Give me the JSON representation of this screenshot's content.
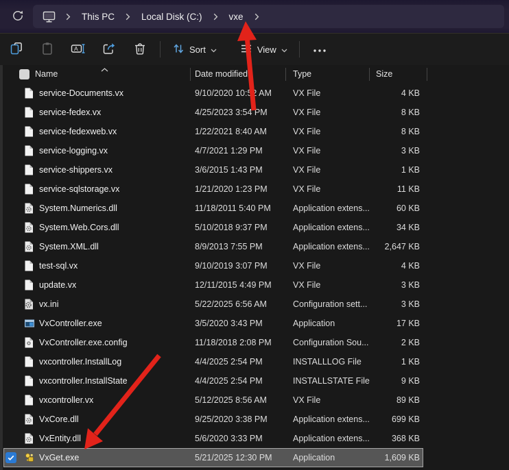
{
  "breadcrumb": {
    "items": [
      "This PC",
      "Local Disk (C:)",
      "vxe"
    ]
  },
  "toolbar": {
    "sort_label": "Sort",
    "view_label": "View",
    "icons": [
      "refresh-icon",
      "copy-icon",
      "paste-icon",
      "rename-icon",
      "share-icon",
      "delete-icon",
      "sort-icon",
      "view-icon",
      "more-icon"
    ]
  },
  "list": {
    "columns": [
      "Name",
      "Date modified",
      "Type",
      "Size"
    ],
    "sort": {
      "column": "Name",
      "direction": "ascending"
    },
    "rows": [
      {
        "name": "service-Documents.vx",
        "date": "9/10/2020 10:52 AM",
        "type": "VX File",
        "size": "4 KB",
        "icon": "file",
        "selected": false
      },
      {
        "name": "service-fedex.vx",
        "date": "4/25/2023 3:54 PM",
        "type": "VX File",
        "size": "8 KB",
        "icon": "file",
        "selected": false
      },
      {
        "name": "service-fedexweb.vx",
        "date": "1/22/2021 8:40 AM",
        "type": "VX File",
        "size": "8 KB",
        "icon": "file",
        "selected": false
      },
      {
        "name": "service-logging.vx",
        "date": "4/7/2021 1:29 PM",
        "type": "VX File",
        "size": "3 KB",
        "icon": "file",
        "selected": false
      },
      {
        "name": "service-shippers.vx",
        "date": "3/6/2015 1:43 PM",
        "type": "VX File",
        "size": "1 KB",
        "icon": "file",
        "selected": false
      },
      {
        "name": "service-sqlstorage.vx",
        "date": "1/21/2020 1:23 PM",
        "type": "VX File",
        "size": "11 KB",
        "icon": "file",
        "selected": false
      },
      {
        "name": "System.Numerics.dll",
        "date": "11/18/2011 5:40 PM",
        "type": "Application extens...",
        "size": "60 KB",
        "icon": "dll",
        "selected": false
      },
      {
        "name": "System.Web.Cors.dll",
        "date": "5/10/2018 9:37 PM",
        "type": "Application extens...",
        "size": "34 KB",
        "icon": "dll",
        "selected": false
      },
      {
        "name": "System.XML.dll",
        "date": "8/9/2013 7:55 PM",
        "type": "Application extens...",
        "size": "2,647 KB",
        "icon": "dll",
        "selected": false
      },
      {
        "name": "test-sql.vx",
        "date": "9/10/2019 3:07 PM",
        "type": "VX File",
        "size": "4 KB",
        "icon": "file",
        "selected": false
      },
      {
        "name": "update.vx",
        "date": "12/11/2015 4:49 PM",
        "type": "VX File",
        "size": "3 KB",
        "icon": "file",
        "selected": false
      },
      {
        "name": "vx.ini",
        "date": "5/22/2025 6:56 AM",
        "type": "Configuration sett...",
        "size": "3 KB",
        "icon": "ini",
        "selected": false
      },
      {
        "name": "VxController.exe",
        "date": "3/5/2020 3:43 PM",
        "type": "Application",
        "size": "17 KB",
        "icon": "exe",
        "selected": false
      },
      {
        "name": "VxController.exe.config",
        "date": "11/18/2018 2:08 PM",
        "type": "Configuration Sou...",
        "size": "2 KB",
        "icon": "config",
        "selected": false
      },
      {
        "name": "vxcontroller.InstallLog",
        "date": "4/4/2025 2:54 PM",
        "type": "INSTALLLOG File",
        "size": "1 KB",
        "icon": "file",
        "selected": false
      },
      {
        "name": "vxcontroller.InstallState",
        "date": "4/4/2025 2:54 PM",
        "type": "INSTALLSTATE File",
        "size": "9 KB",
        "icon": "file",
        "selected": false
      },
      {
        "name": "vxcontroller.vx",
        "date": "5/12/2025 8:56 AM",
        "type": "VX File",
        "size": "89 KB",
        "icon": "file",
        "selected": false
      },
      {
        "name": "VxCore.dll",
        "date": "9/25/2020 3:38 PM",
        "type": "Application extens...",
        "size": "699 KB",
        "icon": "dll",
        "selected": false
      },
      {
        "name": "VxEntity.dll",
        "date": "5/6/2020 3:33 PM",
        "type": "Application extens...",
        "size": "368 KB",
        "icon": "dll",
        "selected": false
      },
      {
        "name": "VxGet.exe",
        "date": "5/21/2025 12:30 PM",
        "type": "Application",
        "size": "1,609 KB",
        "icon": "vxget",
        "selected": true
      }
    ]
  },
  "annotations": {
    "arrow_color": "#e2231a",
    "arrows": [
      {
        "points_at": "breadcrumb item vxe"
      },
      {
        "points_at": "selected row VxGet.exe"
      }
    ]
  },
  "colors": {
    "titlebar_bg": "#251f35",
    "addressbar_bg": "#2e2940",
    "toolbar_bg": "#1c1c1c",
    "list_bg": "#191919",
    "selection_bg": "#565656",
    "selection_border": "#a6a6a6",
    "checkbox_blue": "#2a7ad4",
    "accent_blue_icons": "#4f9fe0"
  }
}
